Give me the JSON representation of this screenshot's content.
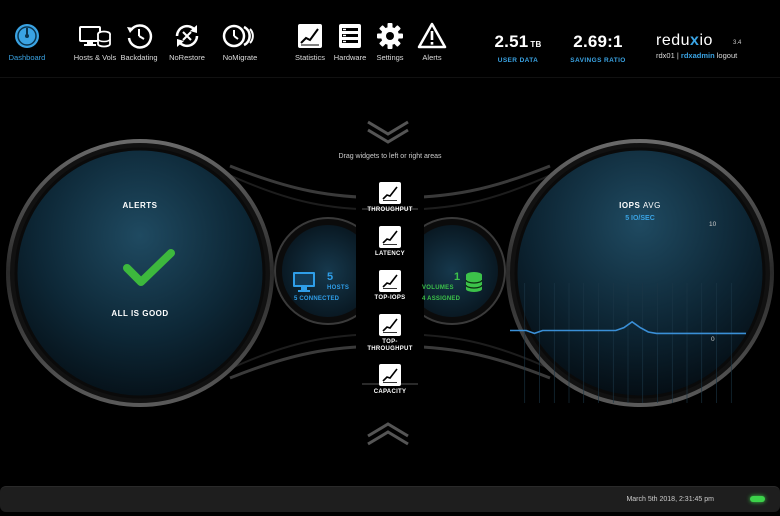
{
  "nav": {
    "items": [
      {
        "id": "dashboard",
        "label": "Dashboard",
        "icon": "dashboard-gauge-icon",
        "active": true
      },
      {
        "id": "hosts",
        "label": "Hosts & Vols",
        "icon": "hosts-volumes-icon"
      },
      {
        "id": "backdating",
        "label": "Backdating",
        "icon": "backdating-clock-icon"
      },
      {
        "id": "norestore",
        "label": "NoRestore",
        "icon": "norestore-icon"
      },
      {
        "id": "nomigrate",
        "label": "NoMigrate",
        "icon": "nomigrate-icon"
      },
      {
        "id": "statistics",
        "label": "Statistics",
        "icon": "statistics-chart-icon"
      },
      {
        "id": "hardware",
        "label": "Hardware",
        "icon": "hardware-server-icon"
      },
      {
        "id": "settings",
        "label": "Settings",
        "icon": "gear-icon"
      },
      {
        "id": "alerts",
        "label": "Alerts",
        "icon": "warning-triangle-icon"
      }
    ]
  },
  "stats": {
    "user_data_value": "2.51",
    "user_data_unit": "TB",
    "user_data_label": "USER DATA",
    "savings_value": "2.69:1",
    "savings_label": "SAVINGS RATIO"
  },
  "brand": {
    "pre": "redu",
    "x": "x",
    "post": "io",
    "version": "3.4"
  },
  "session": {
    "system": "rdx01",
    "separator": "|",
    "user": "rdxadmin",
    "logout": "logout"
  },
  "stage": {
    "hint": "Drag widgets to left or right areas"
  },
  "alerts_panel": {
    "title": "ALERTS",
    "status": "ALL IS GOOD",
    "icon": "checkmark-icon",
    "status_color": "#3db83d"
  },
  "iops_panel": {
    "title": "IOPS",
    "title_suffix": "AVG",
    "value": "5 IO/SEC",
    "y_max_label": "10",
    "y_min_label": "0"
  },
  "hosts_summary": {
    "count": "5",
    "unit": "HOSTS",
    "sub": "5 CONNECTED",
    "color": "#2f9ee8",
    "icon": "monitor-icon"
  },
  "volumes_summary": {
    "count": "1",
    "unit": "VOLUMES",
    "sub": "4 ASSIGNED",
    "color": "#3cc24a",
    "icon": "database-icon"
  },
  "widgets": [
    {
      "id": "throughput",
      "label": "THROUGHPUT",
      "icon": "line-chart-icon"
    },
    {
      "id": "latency",
      "label": "LATENCY",
      "icon": "line-chart-icon"
    },
    {
      "id": "top-iops",
      "label": "TOP-IOPS",
      "icon": "line-chart-icon"
    },
    {
      "id": "top-throughput",
      "label": "TOP-\nTHROUGHPUT",
      "icon": "line-chart-icon"
    },
    {
      "id": "capacity",
      "label": "CAPACITY",
      "icon": "line-chart-icon"
    }
  ],
  "chart_data": {
    "type": "line",
    "title": "IOPS",
    "ylim": [
      0,
      10
    ],
    "series": [
      {
        "values": [
          5,
          5,
          5,
          4.8,
          5,
          5,
          5,
          5,
          5,
          5,
          5,
          5,
          5,
          5,
          5.2,
          5.6,
          5.2,
          4.9,
          4.8,
          4.8,
          4.8,
          4.8,
          4.8,
          4.8,
          4.8,
          4.8,
          4.8,
          4.8,
          4.8,
          4.8
        ]
      }
    ],
    "line_color": "#3a8fd6",
    "grid": true
  },
  "status": {
    "timestamp": "March 5th 2018, 2:31:45 pm",
    "led_color": "#3cd24a"
  }
}
